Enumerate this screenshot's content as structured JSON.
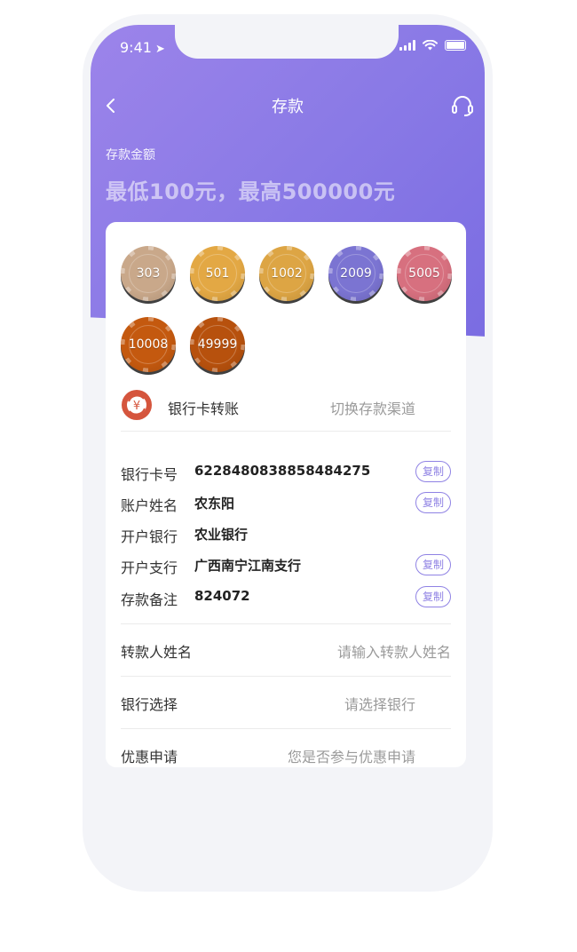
{
  "status_bar": {
    "time": "9:41"
  },
  "nav": {
    "title": "存款"
  },
  "amount": {
    "label": "存款金额",
    "hint": "最低100元，最高500000元"
  },
  "chips": [
    {
      "value": "303",
      "color": "#c9a88a"
    },
    {
      "value": "501",
      "color": "#e3a844"
    },
    {
      "value": "1002",
      "color": "#dda544"
    },
    {
      "value": "2009",
      "color": "#7b74d2"
    },
    {
      "value": "5005",
      "color": "#d7707f"
    },
    {
      "value": "10008",
      "color": "#c4590f"
    },
    {
      "value": "49999",
      "color": "#b7510d"
    }
  ],
  "channel": {
    "name": "银行卡转账",
    "switch_label": "切换存款渠道"
  },
  "bank_info": {
    "card_number": {
      "label": "银行卡号",
      "value": "6228480838858484275",
      "copy": "复制"
    },
    "account_name": {
      "label": "账户姓名",
      "value": "农东阳",
      "copy": "复制"
    },
    "bank": {
      "label": "开户银行",
      "value": "农业银行"
    },
    "branch": {
      "label": "开户支行",
      "value": "广西南宁江南支行",
      "copy": "复制"
    },
    "remark": {
      "label": "存款备注",
      "value": "824072",
      "copy": "复制"
    }
  },
  "form": {
    "depositor": {
      "label": "转款人姓名",
      "placeholder": "请输入转款人姓名"
    },
    "bank_select": {
      "label": "银行选择",
      "placeholder": "请选择银行"
    },
    "promo": {
      "label": "优惠申请",
      "placeholder": "您是否参与优惠申请"
    }
  },
  "colors": {
    "accent": "#8f82e4",
    "header_start": "#9c84ea",
    "header_end": "#7a6ce2"
  }
}
